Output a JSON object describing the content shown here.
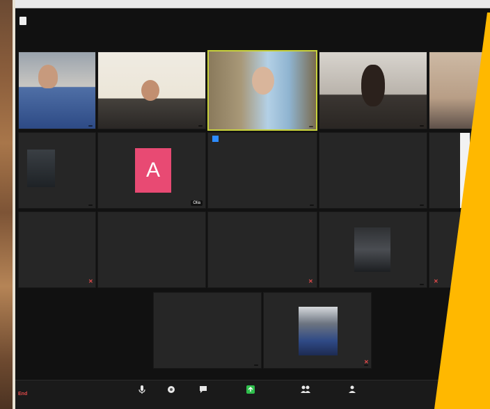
{
  "zoom": {
    "row1": [
      {
        "name": "",
        "active": false
      },
      {
        "name": "",
        "active": false
      },
      {
        "name": "",
        "active": true
      },
      {
        "name": "",
        "active": false
      },
      {
        "name": "",
        "active": false
      }
    ],
    "row2": [
      {
        "name": "",
        "kind": "thumb"
      },
      {
        "name": "Olia",
        "kind": "avatar",
        "avatar_letter": "A"
      },
      {
        "name": "",
        "center": "",
        "kind": "name"
      },
      {
        "name": "",
        "center": "",
        "kind": "name"
      },
      {
        "name": "",
        "kind": "partial"
      }
    ],
    "row3": [
      {
        "center": "",
        "kind": "name"
      },
      {
        "center": "",
        "kind": "name"
      },
      {
        "center": "",
        "kind": "name"
      },
      {
        "name": "",
        "kind": "thumb"
      },
      {
        "name": "",
        "kind": "partial"
      }
    ],
    "row4": [
      {
        "center": "",
        "name": "",
        "kind": "name"
      },
      {
        "name": "",
        "kind": "thumb"
      }
    ],
    "toolbar": {
      "end_label": "End",
      "buttons": [
        {
          "icon": "mic-icon",
          "label": ""
        },
        {
          "icon": "camera-icon",
          "label": ""
        },
        {
          "icon": "chat-icon",
          "label": ""
        },
        {
          "icon": "share-icon",
          "label": ""
        },
        {
          "icon": "participants-icon",
          "label": ""
        },
        {
          "icon": "reactions-icon",
          "label": ""
        }
      ]
    }
  },
  "colors": {
    "avatar": "#e84a73",
    "active_border": "#c8d23c",
    "overlay_yellow": "#ffb800",
    "share_green": "#2fbf4c",
    "muted_red": "#e34a4a"
  }
}
